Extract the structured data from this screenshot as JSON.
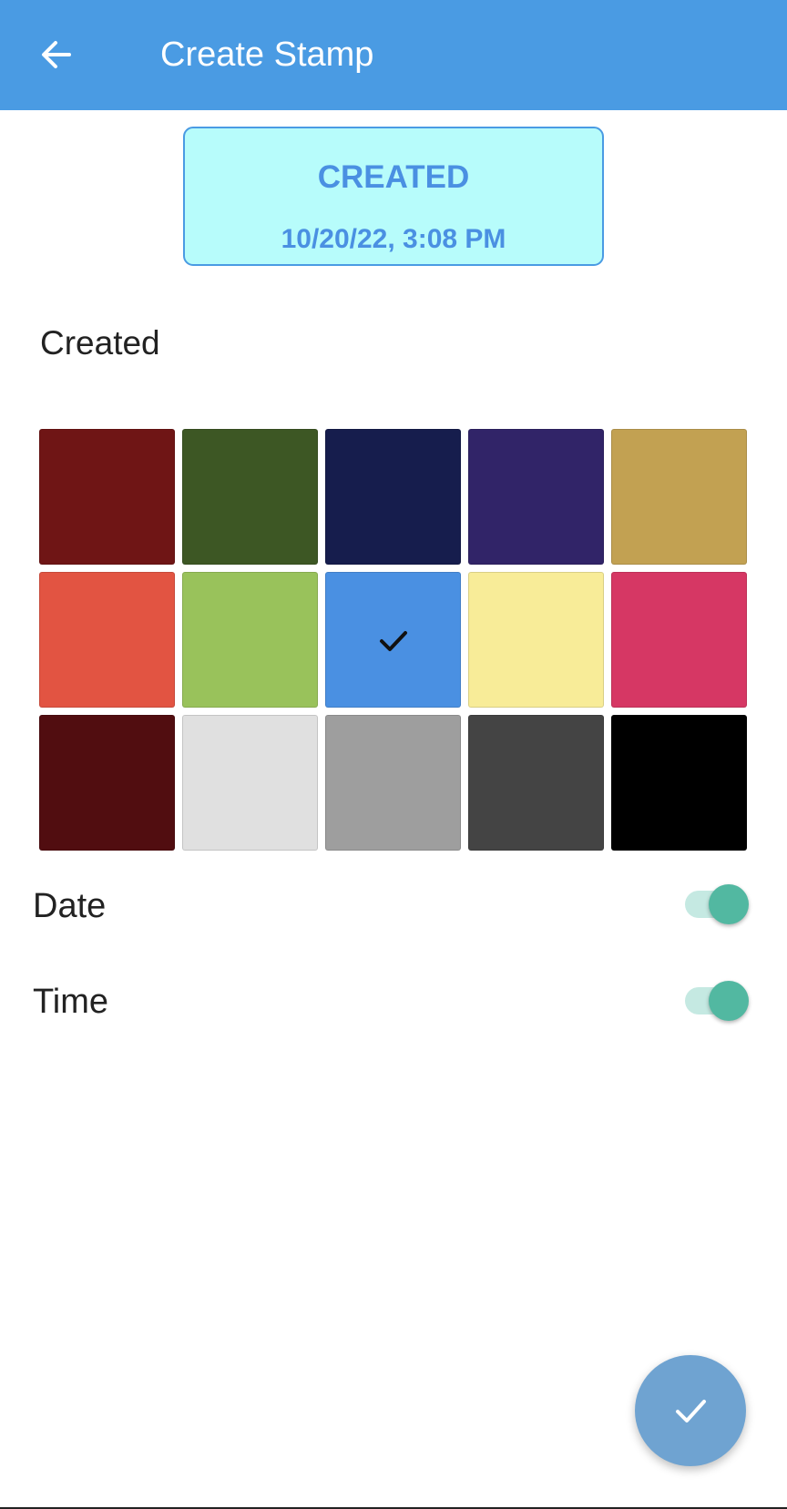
{
  "app_bar": {
    "title": "Create Stamp",
    "back_icon": "arrow-left-icon",
    "background_color": "#4a9be3"
  },
  "stamp_preview": {
    "title": "CREATED",
    "datetime": "10/20/22, 3:08 PM",
    "background_color": "#b7fcfb",
    "text_color": "#4a90e2"
  },
  "stamp_text": {
    "value": "Created"
  },
  "color_palette": {
    "selected_index": 7,
    "colors": [
      "#6f1515",
      "#3d5724",
      "#161d4d",
      "#312468",
      "#c2a152",
      "#e25442",
      "#99c25b",
      "#4a90e2",
      "#f8ec98",
      "#d63764",
      "#510d10",
      "#e0e0e0",
      "#9e9e9e",
      "#444444",
      "#000000"
    ]
  },
  "toggles": [
    {
      "label": "Date",
      "on": true
    },
    {
      "label": "Time",
      "on": true
    }
  ],
  "fab": {
    "icon": "check-icon"
  }
}
